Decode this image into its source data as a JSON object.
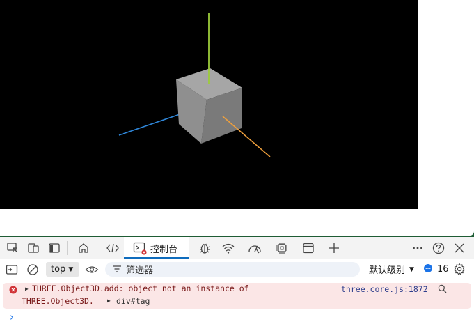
{
  "scene": {
    "axis_colors": {
      "y": "#9ccc3a",
      "x": "#2f86d8",
      "z": "#f0a03c"
    },
    "cube_colors": {
      "top": "#a6a6a6",
      "left": "#8f8f8f",
      "right": "#7a7a7a"
    }
  },
  "toolbar": {
    "active_tab_label": "控制台"
  },
  "filterbar": {
    "context": "top",
    "filter_placeholder": "筛选器",
    "log_level": "默认级别",
    "message_count": "16"
  },
  "console": {
    "error_message_line1": "THREE.Object3D.add: object not an instance of",
    "error_message_line2": "THREE.Object3D.",
    "error_element": "div#tag",
    "error_source": "three.core.js:1872",
    "prompt": "›"
  },
  "colors": {
    "accent": "#0f6cbd",
    "error_bg": "#fbe6e6",
    "error_icon": "#d13438",
    "window_frame": "#1e5c34"
  }
}
